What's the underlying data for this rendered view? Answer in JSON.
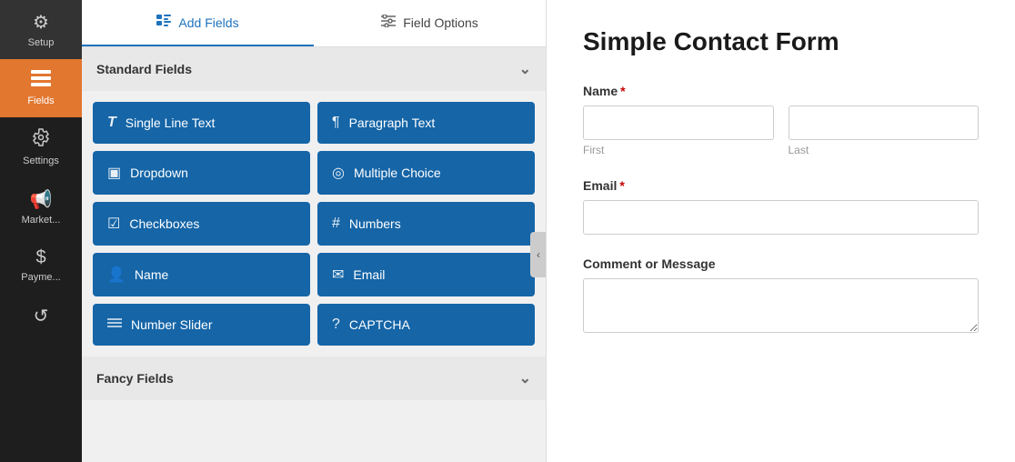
{
  "sidebar": {
    "items": [
      {
        "id": "setup",
        "label": "Setup",
        "icon": "⚙",
        "active": false
      },
      {
        "id": "fields",
        "label": "Fields",
        "icon": "☰",
        "active": true
      },
      {
        "id": "settings",
        "label": "Settings",
        "icon": "⚡",
        "active": false
      },
      {
        "id": "marketing",
        "label": "Market...",
        "icon": "📢",
        "active": false
      },
      {
        "id": "payments",
        "label": "Payme...",
        "icon": "$",
        "active": false
      },
      {
        "id": "history",
        "label": "",
        "icon": "↺",
        "active": false
      }
    ]
  },
  "tabs": [
    {
      "id": "add-fields",
      "label": "Add Fields",
      "icon": "▦",
      "active": true
    },
    {
      "id": "field-options",
      "label": "Field Options",
      "icon": "≡",
      "active": false
    }
  ],
  "sections": [
    {
      "id": "standard-fields",
      "label": "Standard Fields",
      "collapsed": false,
      "fields": [
        {
          "id": "single-line-text",
          "label": "Single Line Text",
          "icon": "T"
        },
        {
          "id": "paragraph-text",
          "label": "Paragraph Text",
          "icon": "¶"
        },
        {
          "id": "dropdown",
          "label": "Dropdown",
          "icon": "▣"
        },
        {
          "id": "multiple-choice",
          "label": "Multiple Choice",
          "icon": "◎"
        },
        {
          "id": "checkboxes",
          "label": "Checkboxes",
          "icon": "☑"
        },
        {
          "id": "numbers",
          "label": "Numbers",
          "icon": "#"
        },
        {
          "id": "name",
          "label": "Name",
          "icon": "👤"
        },
        {
          "id": "email",
          "label": "Email",
          "icon": "✉"
        },
        {
          "id": "number-slider",
          "label": "Number Slider",
          "icon": "≡"
        },
        {
          "id": "captcha",
          "label": "CAPTCHA",
          "icon": "?"
        }
      ]
    },
    {
      "id": "fancy-fields",
      "label": "Fancy Fields",
      "collapsed": false,
      "fields": []
    }
  ],
  "preview": {
    "title": "Simple Contact Form",
    "fields": [
      {
        "id": "name-field",
        "label": "Name",
        "required": true,
        "type": "name",
        "subfields": [
          {
            "id": "first-name",
            "placeholder": "",
            "sublabel": "First"
          },
          {
            "id": "last-name",
            "placeholder": "",
            "sublabel": "Last"
          }
        ]
      },
      {
        "id": "email-field",
        "label": "Email",
        "required": true,
        "type": "email"
      },
      {
        "id": "comment-field",
        "label": "Comment or Message",
        "required": false,
        "type": "textarea"
      }
    ]
  },
  "collapse_handle": {
    "icon": "‹"
  }
}
